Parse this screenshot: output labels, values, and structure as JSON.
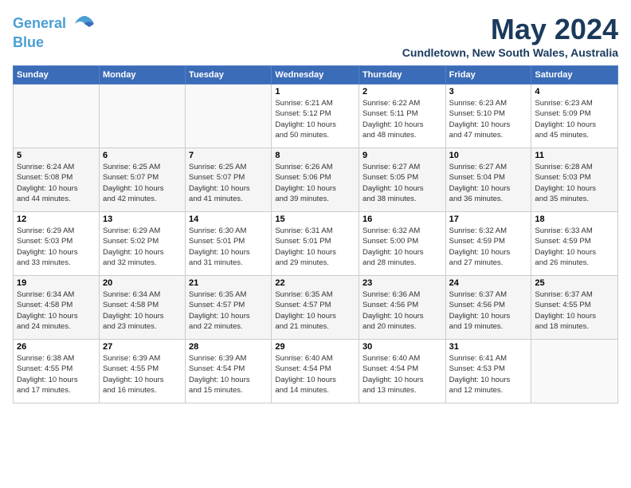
{
  "header": {
    "logo_line1": "General",
    "logo_line2": "Blue",
    "month": "May 2024",
    "location": "Cundletown, New South Wales, Australia"
  },
  "days_of_week": [
    "Sunday",
    "Monday",
    "Tuesday",
    "Wednesday",
    "Thursday",
    "Friday",
    "Saturday"
  ],
  "weeks": [
    [
      {
        "day": "",
        "info": ""
      },
      {
        "day": "",
        "info": ""
      },
      {
        "day": "",
        "info": ""
      },
      {
        "day": "1",
        "info": "Sunrise: 6:21 AM\nSunset: 5:12 PM\nDaylight: 10 hours\nand 50 minutes."
      },
      {
        "day": "2",
        "info": "Sunrise: 6:22 AM\nSunset: 5:11 PM\nDaylight: 10 hours\nand 48 minutes."
      },
      {
        "day": "3",
        "info": "Sunrise: 6:23 AM\nSunset: 5:10 PM\nDaylight: 10 hours\nand 47 minutes."
      },
      {
        "day": "4",
        "info": "Sunrise: 6:23 AM\nSunset: 5:09 PM\nDaylight: 10 hours\nand 45 minutes."
      }
    ],
    [
      {
        "day": "5",
        "info": "Sunrise: 6:24 AM\nSunset: 5:08 PM\nDaylight: 10 hours\nand 44 minutes."
      },
      {
        "day": "6",
        "info": "Sunrise: 6:25 AM\nSunset: 5:07 PM\nDaylight: 10 hours\nand 42 minutes."
      },
      {
        "day": "7",
        "info": "Sunrise: 6:25 AM\nSunset: 5:07 PM\nDaylight: 10 hours\nand 41 minutes."
      },
      {
        "day": "8",
        "info": "Sunrise: 6:26 AM\nSunset: 5:06 PM\nDaylight: 10 hours\nand 39 minutes."
      },
      {
        "day": "9",
        "info": "Sunrise: 6:27 AM\nSunset: 5:05 PM\nDaylight: 10 hours\nand 38 minutes."
      },
      {
        "day": "10",
        "info": "Sunrise: 6:27 AM\nSunset: 5:04 PM\nDaylight: 10 hours\nand 36 minutes."
      },
      {
        "day": "11",
        "info": "Sunrise: 6:28 AM\nSunset: 5:03 PM\nDaylight: 10 hours\nand 35 minutes."
      }
    ],
    [
      {
        "day": "12",
        "info": "Sunrise: 6:29 AM\nSunset: 5:03 PM\nDaylight: 10 hours\nand 33 minutes."
      },
      {
        "day": "13",
        "info": "Sunrise: 6:29 AM\nSunset: 5:02 PM\nDaylight: 10 hours\nand 32 minutes."
      },
      {
        "day": "14",
        "info": "Sunrise: 6:30 AM\nSunset: 5:01 PM\nDaylight: 10 hours\nand 31 minutes."
      },
      {
        "day": "15",
        "info": "Sunrise: 6:31 AM\nSunset: 5:01 PM\nDaylight: 10 hours\nand 29 minutes."
      },
      {
        "day": "16",
        "info": "Sunrise: 6:32 AM\nSunset: 5:00 PM\nDaylight: 10 hours\nand 28 minutes."
      },
      {
        "day": "17",
        "info": "Sunrise: 6:32 AM\nSunset: 4:59 PM\nDaylight: 10 hours\nand 27 minutes."
      },
      {
        "day": "18",
        "info": "Sunrise: 6:33 AM\nSunset: 4:59 PM\nDaylight: 10 hours\nand 26 minutes."
      }
    ],
    [
      {
        "day": "19",
        "info": "Sunrise: 6:34 AM\nSunset: 4:58 PM\nDaylight: 10 hours\nand 24 minutes."
      },
      {
        "day": "20",
        "info": "Sunrise: 6:34 AM\nSunset: 4:58 PM\nDaylight: 10 hours\nand 23 minutes."
      },
      {
        "day": "21",
        "info": "Sunrise: 6:35 AM\nSunset: 4:57 PM\nDaylight: 10 hours\nand 22 minutes."
      },
      {
        "day": "22",
        "info": "Sunrise: 6:35 AM\nSunset: 4:57 PM\nDaylight: 10 hours\nand 21 minutes."
      },
      {
        "day": "23",
        "info": "Sunrise: 6:36 AM\nSunset: 4:56 PM\nDaylight: 10 hours\nand 20 minutes."
      },
      {
        "day": "24",
        "info": "Sunrise: 6:37 AM\nSunset: 4:56 PM\nDaylight: 10 hours\nand 19 minutes."
      },
      {
        "day": "25",
        "info": "Sunrise: 6:37 AM\nSunset: 4:55 PM\nDaylight: 10 hours\nand 18 minutes."
      }
    ],
    [
      {
        "day": "26",
        "info": "Sunrise: 6:38 AM\nSunset: 4:55 PM\nDaylight: 10 hours\nand 17 minutes."
      },
      {
        "day": "27",
        "info": "Sunrise: 6:39 AM\nSunset: 4:55 PM\nDaylight: 10 hours\nand 16 minutes."
      },
      {
        "day": "28",
        "info": "Sunrise: 6:39 AM\nSunset: 4:54 PM\nDaylight: 10 hours\nand 15 minutes."
      },
      {
        "day": "29",
        "info": "Sunrise: 6:40 AM\nSunset: 4:54 PM\nDaylight: 10 hours\nand 14 minutes."
      },
      {
        "day": "30",
        "info": "Sunrise: 6:40 AM\nSunset: 4:54 PM\nDaylight: 10 hours\nand 13 minutes."
      },
      {
        "day": "31",
        "info": "Sunrise: 6:41 AM\nSunset: 4:53 PM\nDaylight: 10 hours\nand 12 minutes."
      },
      {
        "day": "",
        "info": ""
      }
    ]
  ]
}
